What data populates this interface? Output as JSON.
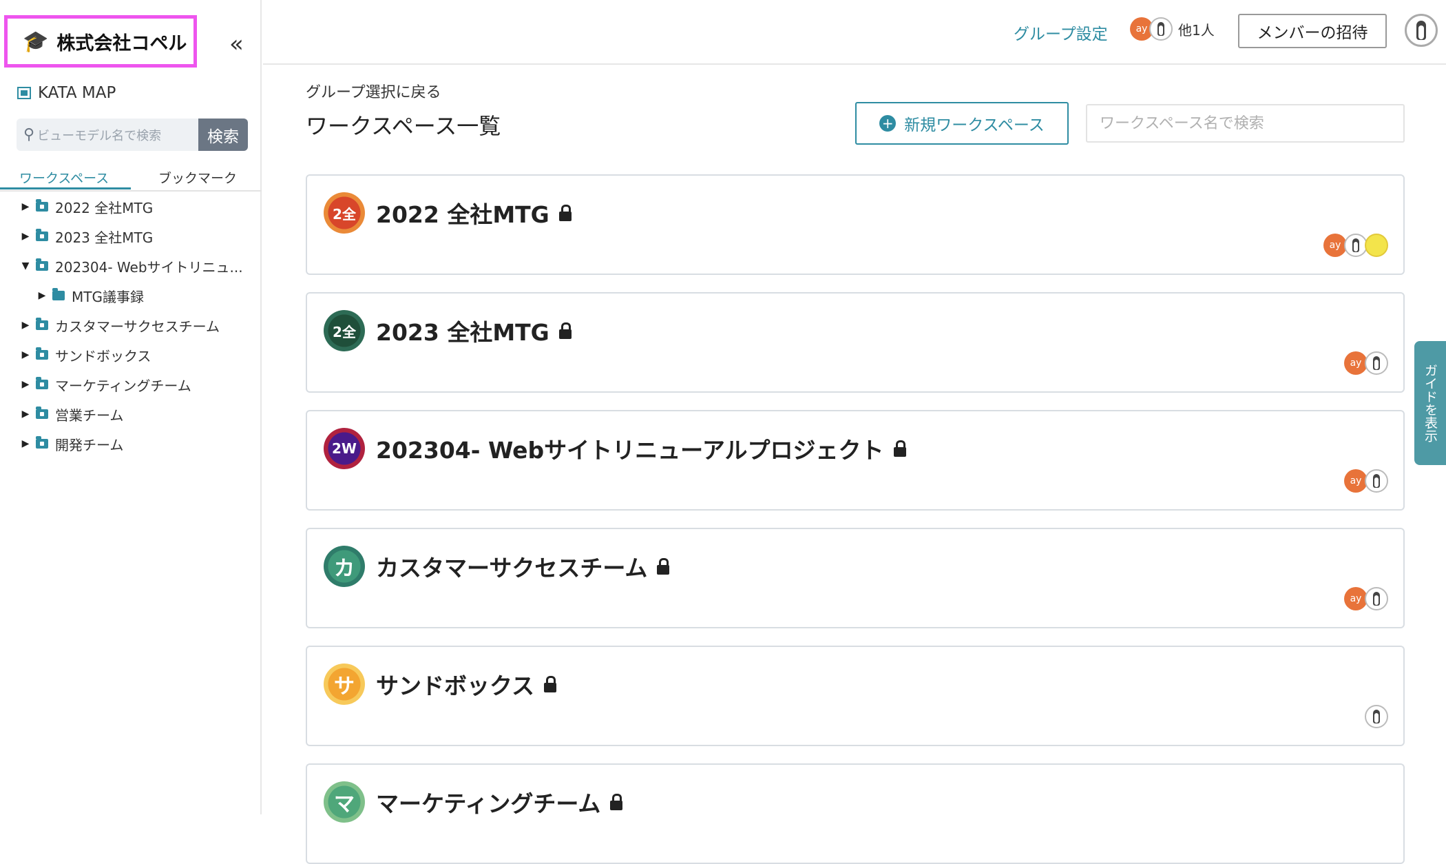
{
  "sidebar": {
    "company_name": "株式会社コペル",
    "collapse_icon": "«",
    "kata_map": "KATA MAP",
    "search_placeholder": "ビューモデル名で検索",
    "search_button": "検索",
    "tabs": [
      "ワークスペース",
      "ブックマーク"
    ],
    "tree": [
      {
        "label": "2022 全社MTG",
        "expanded": false,
        "level": 0
      },
      {
        "label": "2023 全社MTG",
        "expanded": false,
        "level": 0
      },
      {
        "label": "202304- Webサイトリニュ...",
        "expanded": true,
        "level": 0
      },
      {
        "label": "MTG議事録",
        "expanded": false,
        "level": 1
      },
      {
        "label": "カスタマーサクセスチーム",
        "expanded": false,
        "level": 0
      },
      {
        "label": "サンドボックス",
        "expanded": false,
        "level": 0
      },
      {
        "label": "マーケティングチーム",
        "expanded": false,
        "level": 0
      },
      {
        "label": "営業チーム",
        "expanded": false,
        "level": 0
      },
      {
        "label": "開発チーム",
        "expanded": false,
        "level": 0
      }
    ]
  },
  "header": {
    "group_settings": "グループ設定",
    "member_avatar_ay": "ay",
    "others": "他1人",
    "invite_button": "メンバーの招待"
  },
  "main": {
    "back_link": "グループ選択に戻る",
    "title": "ワークスペース一覧",
    "new_workspace_button": "新規ワークスペース",
    "search_placeholder": "ワークスペース名で検索",
    "workspaces": [
      {
        "icon_text": "2全",
        "icon_color": "#e0612b",
        "name": "2022 全社MTG",
        "members": [
          "ay",
          "penguin",
          "yellow"
        ]
      },
      {
        "icon_text": "2全",
        "icon_color": "#215a44",
        "name": "2023 全社MTG",
        "members": [
          "ay",
          "penguin"
        ]
      },
      {
        "icon_text": "2W",
        "icon_color": "#6a1b7a",
        "name": "202304- Webサイトリニューアルプロジェクト",
        "members": [
          "ay",
          "penguin"
        ]
      },
      {
        "icon_text": "カ",
        "icon_color": "#3f9a7a",
        "name": "カスタマーサクセスチーム",
        "members": [
          "ay",
          "penguin"
        ]
      },
      {
        "icon_text": "サ",
        "icon_color": "#f0b43c",
        "name": "サンドボックス",
        "members": [
          "penguin"
        ]
      },
      {
        "icon_text": "マ",
        "icon_color": "#4fa77a",
        "name": "マーケティングチーム",
        "members": []
      }
    ]
  },
  "guide_tab": "ガイドを表示",
  "colors": {
    "accent": "#2e8ca2",
    "highlight": "#ee55ee",
    "avatar_ay": "#e8733a"
  }
}
